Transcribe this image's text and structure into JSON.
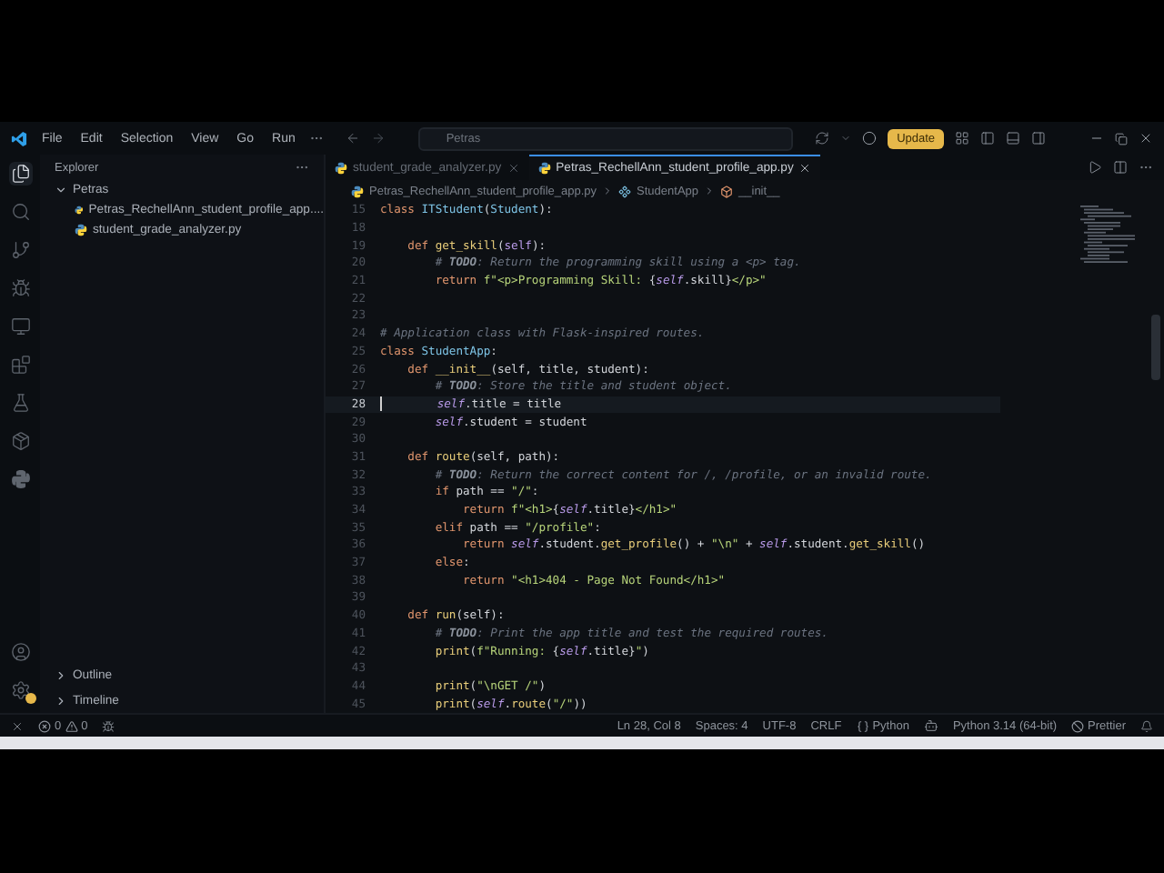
{
  "title_bar": {
    "menus": [
      "File",
      "Edit",
      "Selection",
      "View",
      "Go",
      "Run"
    ],
    "search": {
      "value": "Petras"
    },
    "update_button": "Update"
  },
  "activity_bar": {
    "items": [
      {
        "selected": true
      },
      {
        "selected": false
      },
      {
        "selected": false
      },
      {
        "selected": false
      },
      {
        "selected": false
      },
      {
        "selected": false
      },
      {
        "selected": false
      },
      {
        "selected": false
      },
      {
        "selected": false
      }
    ]
  },
  "explorer": {
    "title": "Explorer",
    "folder": {
      "name": "Petras",
      "expanded": true,
      "children": [
        {
          "name": "Petras_RechellAnn_student_profile_app...."
        },
        {
          "name": "student_grade_analyzer.py"
        }
      ]
    },
    "sections": [
      {
        "name": "Outline",
        "expanded": false
      },
      {
        "name": "Timeline",
        "expanded": false
      }
    ]
  },
  "tabs": [
    {
      "label": "student_grade_analyzer.py",
      "selected": false
    },
    {
      "label": "Petras_RechellAnn_student_profile_app.py",
      "selected": true
    }
  ],
  "breadcrumb": [
    "Petras_RechellAnn_student_profile_app.py",
    "StudentApp",
    "__init__"
  ],
  "editor": {
    "lines": [
      {
        "number": "15",
        "current": false,
        "tokens": [
          {
            "text": "class ",
            "kind": "keyword"
          },
          {
            "text": "ITStudent",
            "kind": "class"
          },
          {
            "text": "(",
            "kind": "plain"
          },
          {
            "text": "Student",
            "kind": "class"
          },
          {
            "text": "):",
            "kind": "plain"
          }
        ]
      },
      {
        "number": "18",
        "current": false
      },
      {
        "number": "19",
        "current": false,
        "tokens": [
          {
            "text": "    def ",
            "kind": "keyword"
          },
          {
            "text": "get_skill",
            "kind": "function"
          },
          {
            "text": "(",
            "kind": "plain"
          },
          {
            "text": "self",
            "kind": "param"
          },
          {
            "text": "):",
            "kind": "plain"
          }
        ]
      },
      {
        "number": "20",
        "current": false,
        "tokens": [
          {
            "text": "        # ",
            "kind": "comment"
          },
          {
            "text": "TODO",
            "kind": "todo"
          },
          {
            "text": ": Return the programming skill using a <p> tag.",
            "kind": "comment"
          }
        ]
      },
      {
        "number": "21",
        "current": false,
        "tokens": [
          {
            "text": "        return ",
            "kind": "keyword"
          },
          {
            "text": "f\"<p>Programming Skill: ",
            "kind": "string"
          },
          {
            "text": "{",
            "kind": "plain"
          },
          {
            "text": "self",
            "kind": "self"
          },
          {
            "text": ".skill}",
            "kind": "plain"
          },
          {
            "text": "</p>\"",
            "kind": "string"
          }
        ]
      },
      {
        "number": "22",
        "current": false
      },
      {
        "number": "23",
        "current": false
      },
      {
        "number": "24",
        "current": false,
        "tokens": [
          {
            "text": "# Application class with Flask-inspired routes.",
            "kind": "comment"
          }
        ]
      },
      {
        "number": "25",
        "current": false,
        "tokens": [
          {
            "text": "class ",
            "kind": "keyword"
          },
          {
            "text": "StudentApp",
            "kind": "class"
          },
          {
            "text": ":",
            "kind": "plain"
          }
        ]
      },
      {
        "number": "26",
        "current": false,
        "tokens": [
          {
            "text": "    def ",
            "kind": "keyword"
          },
          {
            "text": "__init__",
            "kind": "function"
          },
          {
            "text": "(self, title, student):",
            "kind": "plain"
          }
        ]
      },
      {
        "number": "27",
        "current": false,
        "tokens": [
          {
            "text": "        # ",
            "kind": "comment"
          },
          {
            "text": "TODO",
            "kind": "todo"
          },
          {
            "text": ": Store the title and student object.",
            "kind": "comment"
          }
        ]
      },
      {
        "number": "28",
        "current": true,
        "tokens": [
          {
            "text": "        self",
            "kind": "self"
          },
          {
            "text": ".title = title",
            "kind": "plain"
          }
        ]
      },
      {
        "number": "29",
        "current": false,
        "tokens": [
          {
            "text": "        self",
            "kind": "self"
          },
          {
            "text": ".student = student",
            "kind": "plain"
          }
        ]
      },
      {
        "number": "30",
        "current": false
      },
      {
        "number": "31",
        "current": false,
        "tokens": [
          {
            "text": "    def ",
            "kind": "keyword"
          },
          {
            "text": "route",
            "kind": "function"
          },
          {
            "text": "(self, path):",
            "kind": "plain"
          }
        ]
      },
      {
        "number": "32",
        "current": false,
        "tokens": [
          {
            "text": "        # ",
            "kind": "comment"
          },
          {
            "text": "TODO",
            "kind": "todo"
          },
          {
            "text": ": Return the correct content for /, /profile, or an invalid route.",
            "kind": "comment"
          }
        ]
      },
      {
        "number": "33",
        "current": false,
        "tokens": [
          {
            "text": "        if ",
            "kind": "keyword"
          },
          {
            "text": "path == ",
            "kind": "plain"
          },
          {
            "text": "\"/\"",
            "kind": "string"
          },
          {
            "text": ":",
            "kind": "plain"
          }
        ]
      },
      {
        "number": "34",
        "current": false,
        "tokens": [
          {
            "text": "            return ",
            "kind": "keyword"
          },
          {
            "text": "f\"<h1>",
            "kind": "string"
          },
          {
            "text": "{",
            "kind": "plain"
          },
          {
            "text": "self",
            "kind": "self"
          },
          {
            "text": ".title}",
            "kind": "plain"
          },
          {
            "text": "</h1>\"",
            "kind": "string"
          }
        ]
      },
      {
        "number": "35",
        "current": false,
        "tokens": [
          {
            "text": "        elif ",
            "kind": "keyword"
          },
          {
            "text": "path == ",
            "kind": "plain"
          },
          {
            "text": "\"/profile\"",
            "kind": "string"
          },
          {
            "text": ":",
            "kind": "plain"
          }
        ]
      },
      {
        "number": "36",
        "current": false,
        "tokens": [
          {
            "text": "            return ",
            "kind": "keyword"
          },
          {
            "text": "self",
            "kind": "self"
          },
          {
            "text": ".student.",
            "kind": "plain"
          },
          {
            "text": "get_profile",
            "kind": "function"
          },
          {
            "text": "() + ",
            "kind": "plain"
          },
          {
            "text": "\"\\n\"",
            "kind": "string"
          },
          {
            "text": " + ",
            "kind": "plain"
          },
          {
            "text": "self",
            "kind": "self"
          },
          {
            "text": ".student.",
            "kind": "plain"
          },
          {
            "text": "get_skill",
            "kind": "function"
          },
          {
            "text": "()",
            "kind": "plain"
          }
        ]
      },
      {
        "number": "37",
        "current": false,
        "tokens": [
          {
            "text": "        else",
            "kind": "keyword"
          },
          {
            "text": ":",
            "kind": "plain"
          }
        ]
      },
      {
        "number": "38",
        "current": false,
        "tokens": [
          {
            "text": "            return ",
            "kind": "keyword"
          },
          {
            "text": "\"<h1>404 - Page Not Found</h1>\"",
            "kind": "string"
          }
        ]
      },
      {
        "number": "39",
        "current": false
      },
      {
        "number": "40",
        "current": false,
        "tokens": [
          {
            "text": "    def ",
            "kind": "keyword"
          },
          {
            "text": "run",
            "kind": "function"
          },
          {
            "text": "(self):",
            "kind": "plain"
          }
        ]
      },
      {
        "number": "41",
        "current": false,
        "tokens": [
          {
            "text": "        # ",
            "kind": "comment"
          },
          {
            "text": "TODO",
            "kind": "todo"
          },
          {
            "text": ": Print the app title and test the required routes.",
            "kind": "comment"
          }
        ]
      },
      {
        "number": "42",
        "current": false,
        "tokens": [
          {
            "text": "        print",
            "kind": "function"
          },
          {
            "text": "(",
            "kind": "plain"
          },
          {
            "text": "f\"Running: ",
            "kind": "string"
          },
          {
            "text": "{",
            "kind": "plain"
          },
          {
            "text": "self",
            "kind": "self"
          },
          {
            "text": ".title}",
            "kind": "plain"
          },
          {
            "text": "\"",
            "kind": "string"
          },
          {
            "text": ")",
            "kind": "plain"
          }
        ]
      },
      {
        "number": "43",
        "current": false
      },
      {
        "number": "44",
        "current": false,
        "tokens": [
          {
            "text": "        print",
            "kind": "function"
          },
          {
            "text": "(",
            "kind": "plain"
          },
          {
            "text": "\"\\nGET /\"",
            "kind": "string"
          },
          {
            "text": ")",
            "kind": "plain"
          }
        ]
      },
      {
        "number": "45",
        "current": false,
        "tokens": [
          {
            "text": "        print",
            "kind": "function"
          },
          {
            "text": "(",
            "kind": "plain"
          },
          {
            "text": "self",
            "kind": "self"
          },
          {
            "text": ".",
            "kind": "plain"
          },
          {
            "text": "route",
            "kind": "function"
          },
          {
            "text": "(",
            "kind": "plain"
          },
          {
            "text": "\"/\"",
            "kind": "string"
          },
          {
            "text": "))",
            "kind": "plain"
          }
        ]
      }
    ]
  },
  "status_bar": {
    "errors": "0",
    "warnings": "0",
    "items": [
      {
        "text": "Ln 28, Col 8",
        "kind": "plain"
      },
      {
        "text": "Spaces: 4",
        "kind": "plain"
      },
      {
        "text": "UTF-8",
        "kind": "plain"
      },
      {
        "text": "CRLF",
        "kind": "plain"
      },
      {
        "text": "Python",
        "kind": "language"
      },
      {
        "text": "Python 3.14 (64-bit)",
        "kind": "interpreter"
      },
      {
        "text": "Prettier",
        "kind": "formatter"
      }
    ]
  }
}
